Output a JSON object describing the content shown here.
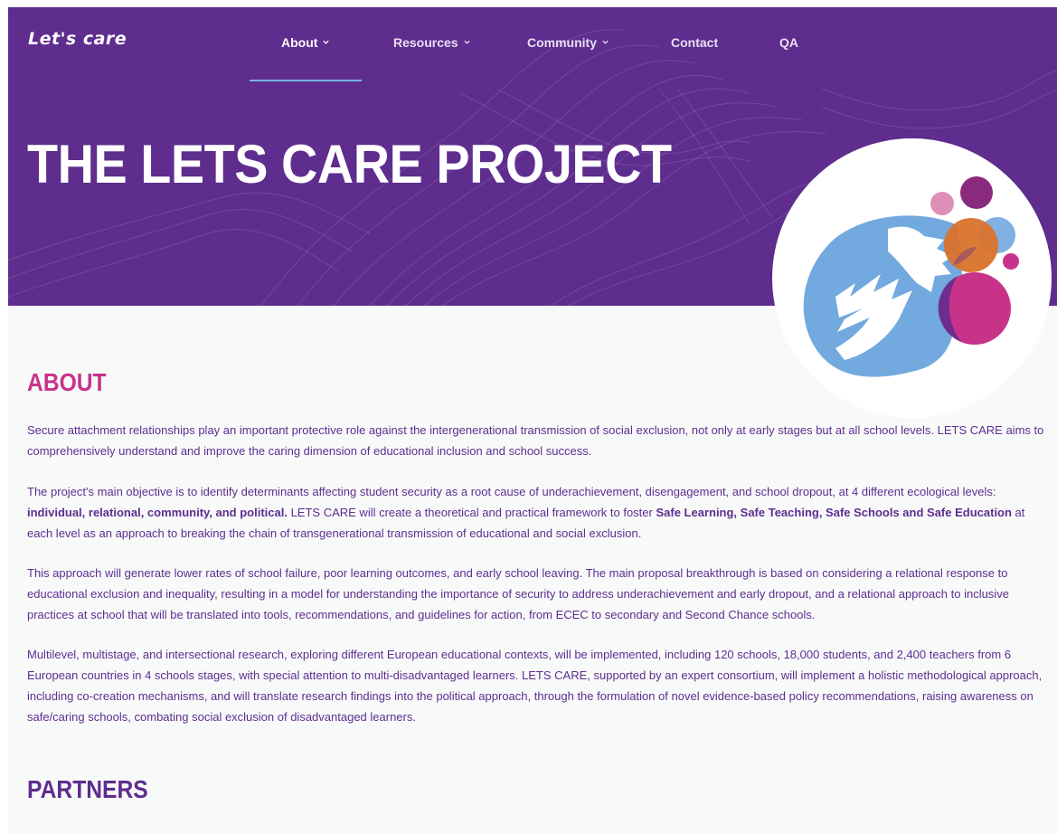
{
  "brand": {
    "logo": "Let's care"
  },
  "nav": {
    "items": [
      {
        "label": "About",
        "has_dropdown": true,
        "active": true
      },
      {
        "label": "Resources",
        "has_dropdown": true,
        "active": false
      },
      {
        "label": "Community",
        "has_dropdown": true,
        "active": false
      },
      {
        "label": "Contact",
        "has_dropdown": false,
        "active": false
      },
      {
        "label": "QA",
        "has_dropdown": false,
        "active": false
      }
    ]
  },
  "hero": {
    "title": "THE LETS CARE PROJECT",
    "image_icon": "hands-and-bubbles-illustration"
  },
  "about": {
    "title": "ABOUT",
    "p1": {
      "text": "Secure attachment relationships play an important protective role against the intergenerational transmission of social exclusion, not only at early stages but at all school levels. LETS CARE aims to comprehensively understand and improve the caring dimension of educational inclusion and school success."
    },
    "p2": {
      "a": "The project's main objective is to identify determinants affecting student security as a root cause of underachievement, disengagement, and school dropout, at 4 different ecological levels: ",
      "b1": "individual, relational, community, and political.",
      "c": " LETS CARE will create a theoretical and practical framework to foster ",
      "b2": "Safe Learning, Safe Teaching, Safe Schools and Safe Education",
      "d": " at each level as an approach to breaking the chain of transgenerational transmission of educational and social exclusion."
    },
    "p3": {
      "text": "This approach will generate lower rates of school failure, poor learning outcomes, and early school leaving. The main proposal breakthrough is based on considering a relational response to educational exclusion and inequality, resulting in a model for understanding the importance of security to address underachievement and early dropout, and a relational approach to inclusive practices at school that will be translated into tools, recommendations, and guidelines for action, from ECEC to secondary and Second Chance schools."
    },
    "p4": {
      "text": "Multilevel, multistage, and intersectional research, exploring different European educational contexts, will be implemented, including 120 schools, 18,000 students, and 2,400 teachers from 6 European countries in 4 schools stages, with special attention to multi-disadvantaged learners. LETS CARE, supported by an expert consortium, will implement a holistic methodological approach, including co-creation mechanisms, and will translate research findings into the political approach, through the formulation of novel evidence-based policy recommendations, raising awareness on safe/caring schools, combating social exclusion of disadvantaged learners."
    }
  },
  "partners": {
    "title": "PARTNERS"
  },
  "colors": {
    "brand_purple": "#5e2d8e",
    "accent_pink": "#c8338a",
    "nav_underline": "#79b2e0",
    "content_bg": "#f8fafa",
    "hand_blue": "#72a9df",
    "bubble_orange": "#d9722c",
    "bubble_magenta": "#c8338a",
    "bubble_plum": "#8a2a7e",
    "bubble_pink": "#de8fb8"
  }
}
